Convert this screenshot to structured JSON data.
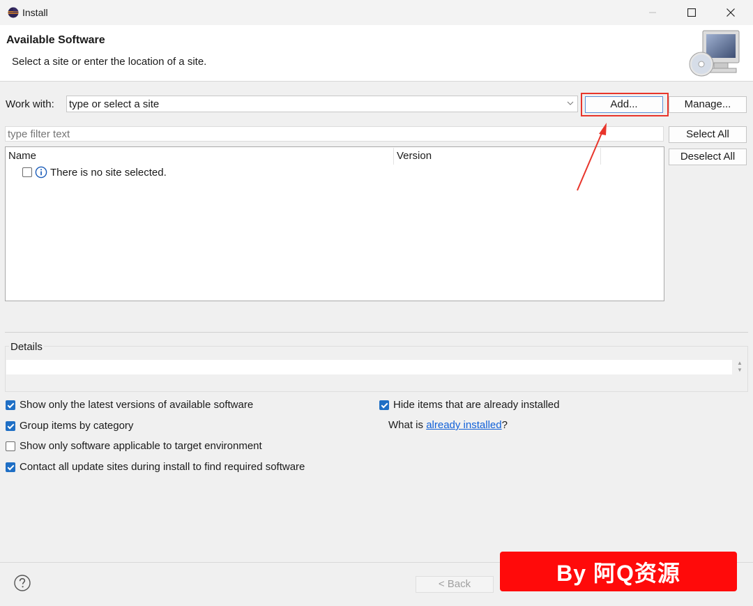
{
  "window": {
    "title": "Install",
    "icon": "eclipse-icon"
  },
  "banner": {
    "title": "Available Software",
    "subtitle": "Select a site or enter the location of a site.",
    "graphic": "monitor-cd-icon"
  },
  "work_with": {
    "label": "Work with:",
    "combo_value": "type or select a site",
    "add_label": "Add...",
    "manage_label": "Manage..."
  },
  "filter": {
    "placeholder": "type filter text"
  },
  "buttons": {
    "select_all": "Select All",
    "deselect_all": "Deselect All"
  },
  "table": {
    "columns": [
      "Name",
      "Version"
    ],
    "rows": [
      {
        "text": "There is no site selected.",
        "checked": false,
        "icon": "info-icon"
      }
    ]
  },
  "details": {
    "label": "Details",
    "text": ""
  },
  "options": {
    "latest_versions": {
      "label": "Show only the latest versions of available software",
      "checked": true
    },
    "group_by_category": {
      "label": "Group items by category",
      "checked": true
    },
    "applicable_target": {
      "label": "Show only software applicable to target environment",
      "checked": false
    },
    "contact_sites": {
      "label": "Contact all update sites during install to find required software",
      "checked": true
    },
    "hide_installed": {
      "label": "Hide items that are already installed",
      "checked": true
    },
    "what_is_prefix": "What is ",
    "what_is_link": "already installed",
    "what_is_suffix": "?"
  },
  "footer": {
    "back_label": "< Back"
  },
  "watermark": {
    "text": "By 阿Q资源"
  },
  "colors": {
    "highlight": "#e8352b",
    "watermark_bg": "#ff0a0a",
    "checkbox": "#1f6fc5",
    "link": "#1060d8"
  }
}
